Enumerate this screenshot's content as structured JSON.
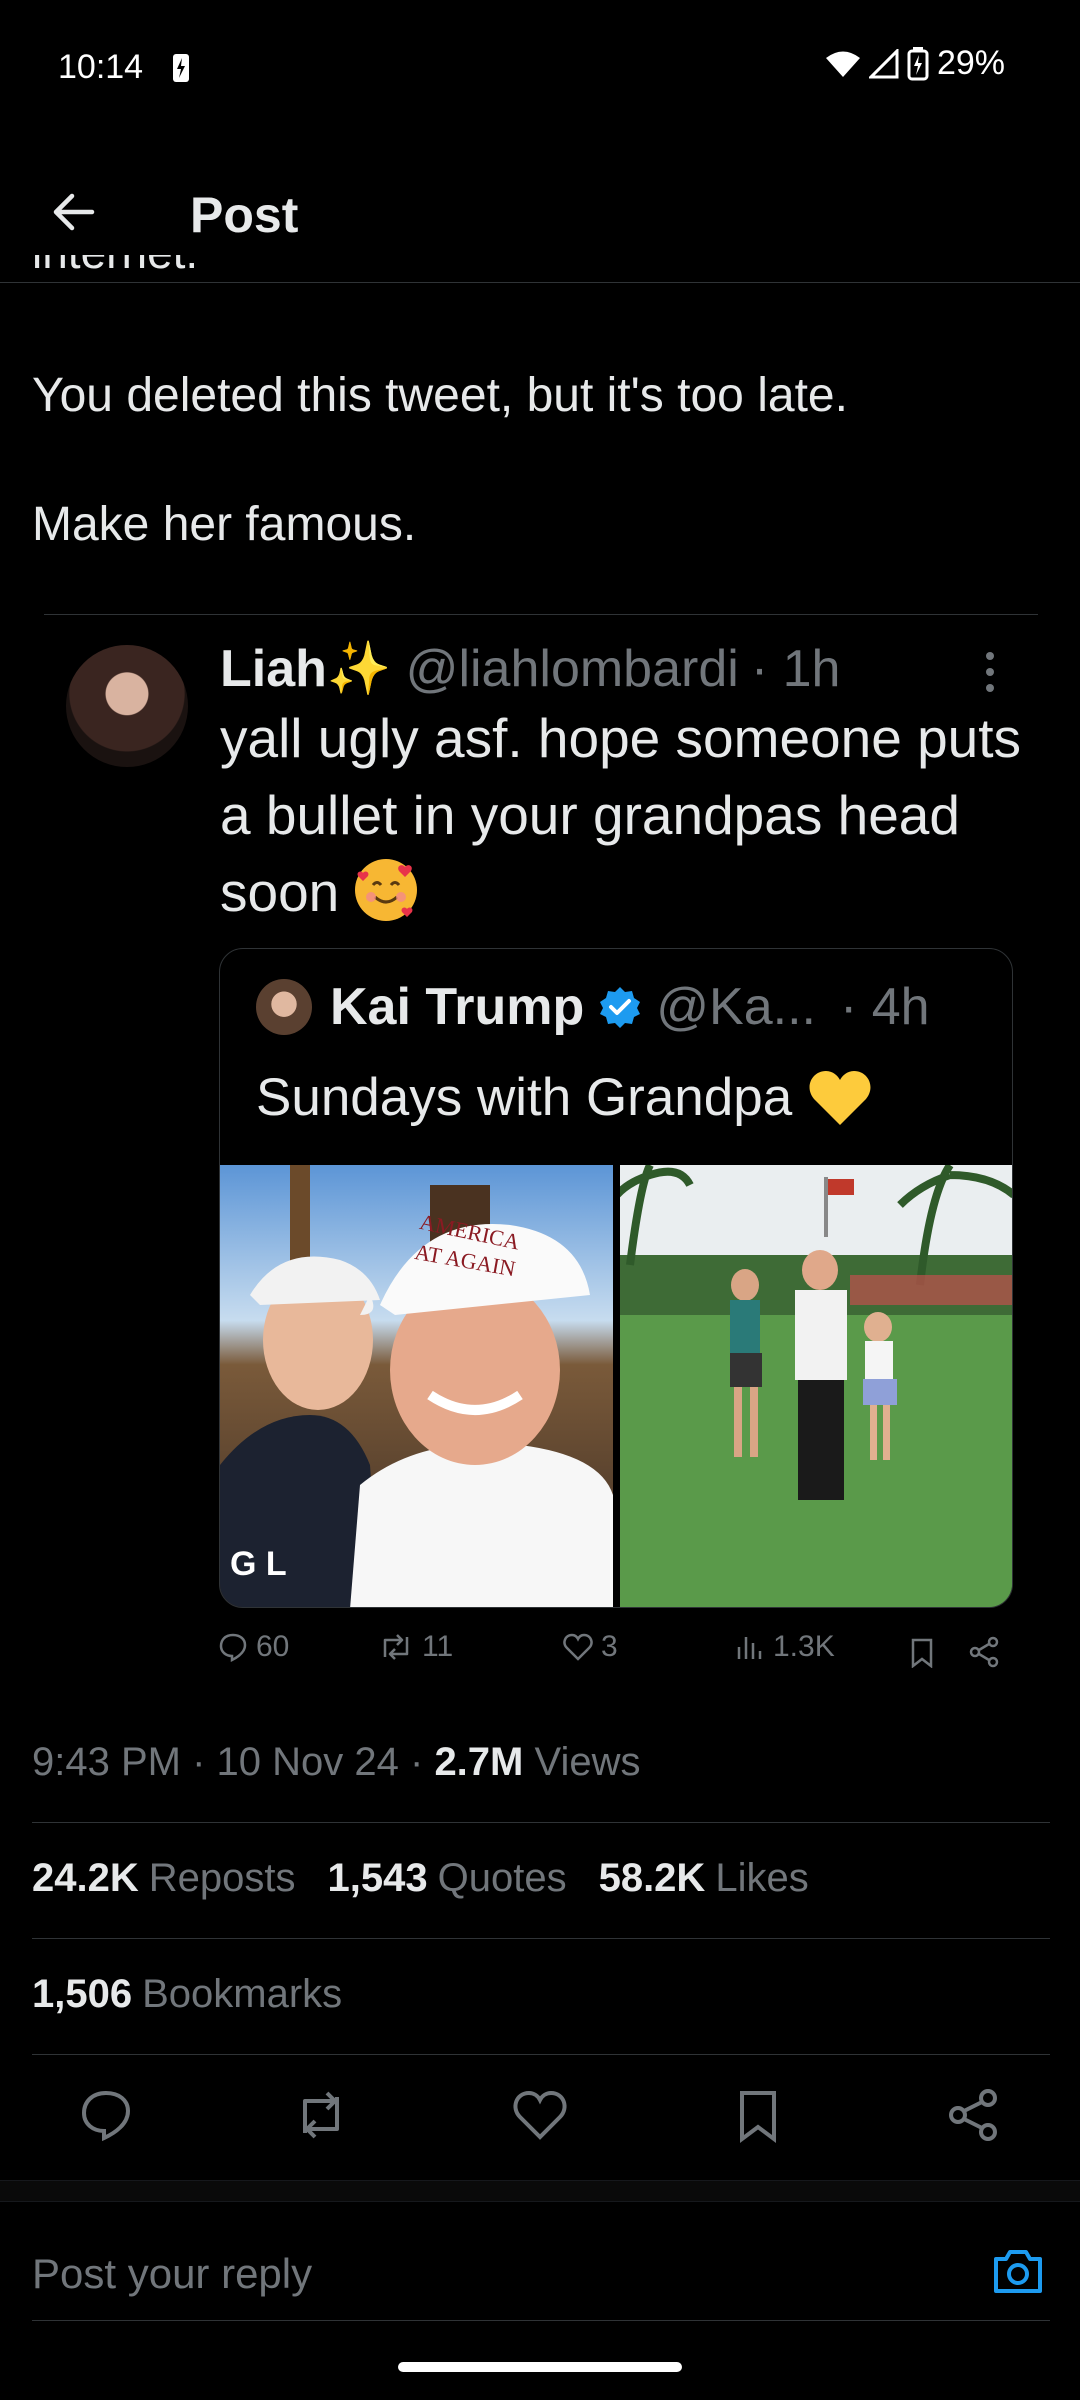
{
  "status_bar": {
    "time": "10:14",
    "battery_percent": "29%",
    "icons": [
      "charging-bolt-icon",
      "wifi-icon",
      "signal-icon",
      "battery-icon"
    ]
  },
  "header": {
    "title": "Post",
    "back_icon": "back-arrow-icon"
  },
  "post": {
    "cut_off_text": "internet.",
    "lines": [
      "You deleted this tweet, but it's too late.",
      "Make her famous."
    ],
    "quoted": {
      "name": "Liah",
      "sparkle": "✨",
      "handle": "@liahlombardi",
      "time": "· 1h",
      "text": "yall ugly asf. hope someone puts a bullet in your grandpas head soon",
      "emoji": "smiling-face-with-hearts",
      "inner_quote": {
        "name": "Kai Trump",
        "handle": "@Ka...",
        "time": "· 4h",
        "text": "Sundays with Grandpa",
        "emoji": "yellow-heart",
        "photo_hat_text": [
          "AMERICA",
          "AT AGAIN"
        ],
        "photo_shirt_text": "G L"
      },
      "actions": {
        "replies": "60",
        "reposts": "11",
        "likes": "3",
        "views": "1.3K"
      }
    },
    "meta": {
      "time": "9:43 PM",
      "date": "10 Nov 24",
      "views_count": "2.7M",
      "views_label": "Views"
    },
    "stats": {
      "reposts_count": "24.2K",
      "reposts_label": "Reposts",
      "quotes_count": "1,543",
      "quotes_label": "Quotes",
      "likes_count": "58.2K",
      "likes_label": "Likes",
      "bookmarks_count": "1,506",
      "bookmarks_label": "Bookmarks"
    }
  },
  "reply": {
    "placeholder": "Post your reply"
  },
  "colors": {
    "background": "#000000",
    "text": "#e7e9ea",
    "secondary": "#71767b",
    "divider": "#2f3336",
    "accent": "#1d9bf0"
  }
}
